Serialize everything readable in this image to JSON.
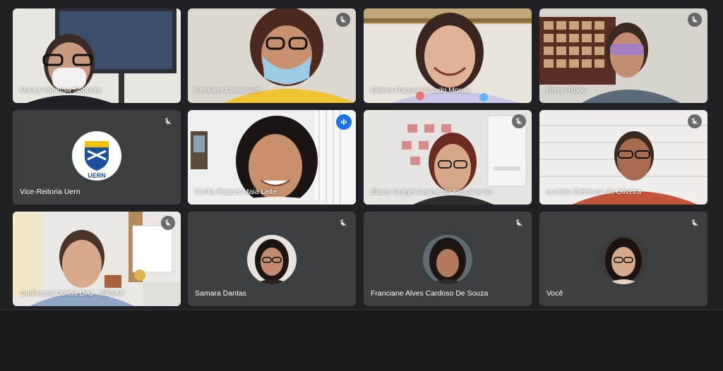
{
  "participants": [
    {
      "name": "Maura Vanessa Sobreira",
      "muted": false
    },
    {
      "name": "Emiliana Cavalcanti",
      "muted": true
    },
    {
      "name": "Fátima Raquel Rosado Morais",
      "muted": false
    },
    {
      "name": "Breno Roos",
      "muted": true
    },
    {
      "name": "Vice-Reitoria Uern",
      "muted": true
    },
    {
      "name": "Cicília Raquel Maia Leite",
      "muted": false,
      "speaking": true
    },
    {
      "name": "Ellany Gurgel Cosme do Nascimento",
      "muted": true
    },
    {
      "name": "Lucídio Clebeson de Oliveira",
      "muted": true
    },
    {
      "name": "Guilherme Uchôa DAJ - SESAP",
      "muted": true
    },
    {
      "name": "Samara Dantas",
      "muted": true
    },
    {
      "name": "Franciane Alves Cardoso De Souza",
      "muted": true
    },
    {
      "name": "Você",
      "muted": true
    }
  ],
  "logo": {
    "text": "UERN"
  },
  "colors": {
    "background": "#202124",
    "tile": "#3c4043",
    "active_border": "#8ab4f8",
    "speaking_badge": "#1a73e8"
  },
  "icons": {
    "mic_off": "mic-off-icon",
    "speaking": "audio-level-icon"
  }
}
